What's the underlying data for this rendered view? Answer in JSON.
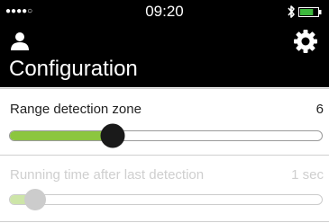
{
  "status_bar": {
    "signal": "●●●●○",
    "time": "09:20",
    "icons": [
      "bluetooth-icon",
      "battery-icon"
    ],
    "battery_level": 0.75
  },
  "header": {
    "title": "Configuration",
    "left_icon": "user-icon",
    "right_icon": "gear-icon"
  },
  "settings": [
    {
      "label": "Range detection zone",
      "value": "6",
      "slider_fraction": 0.33,
      "enabled": true
    },
    {
      "label": "Running time after last detection",
      "value": "1 sec",
      "slider_fraction": 0.08,
      "enabled": false
    }
  ],
  "colors": {
    "header_bg": "#000000",
    "accent": "#8cc63f",
    "thumb_active": "#1a1a1a",
    "disabled": "#cccccc"
  }
}
